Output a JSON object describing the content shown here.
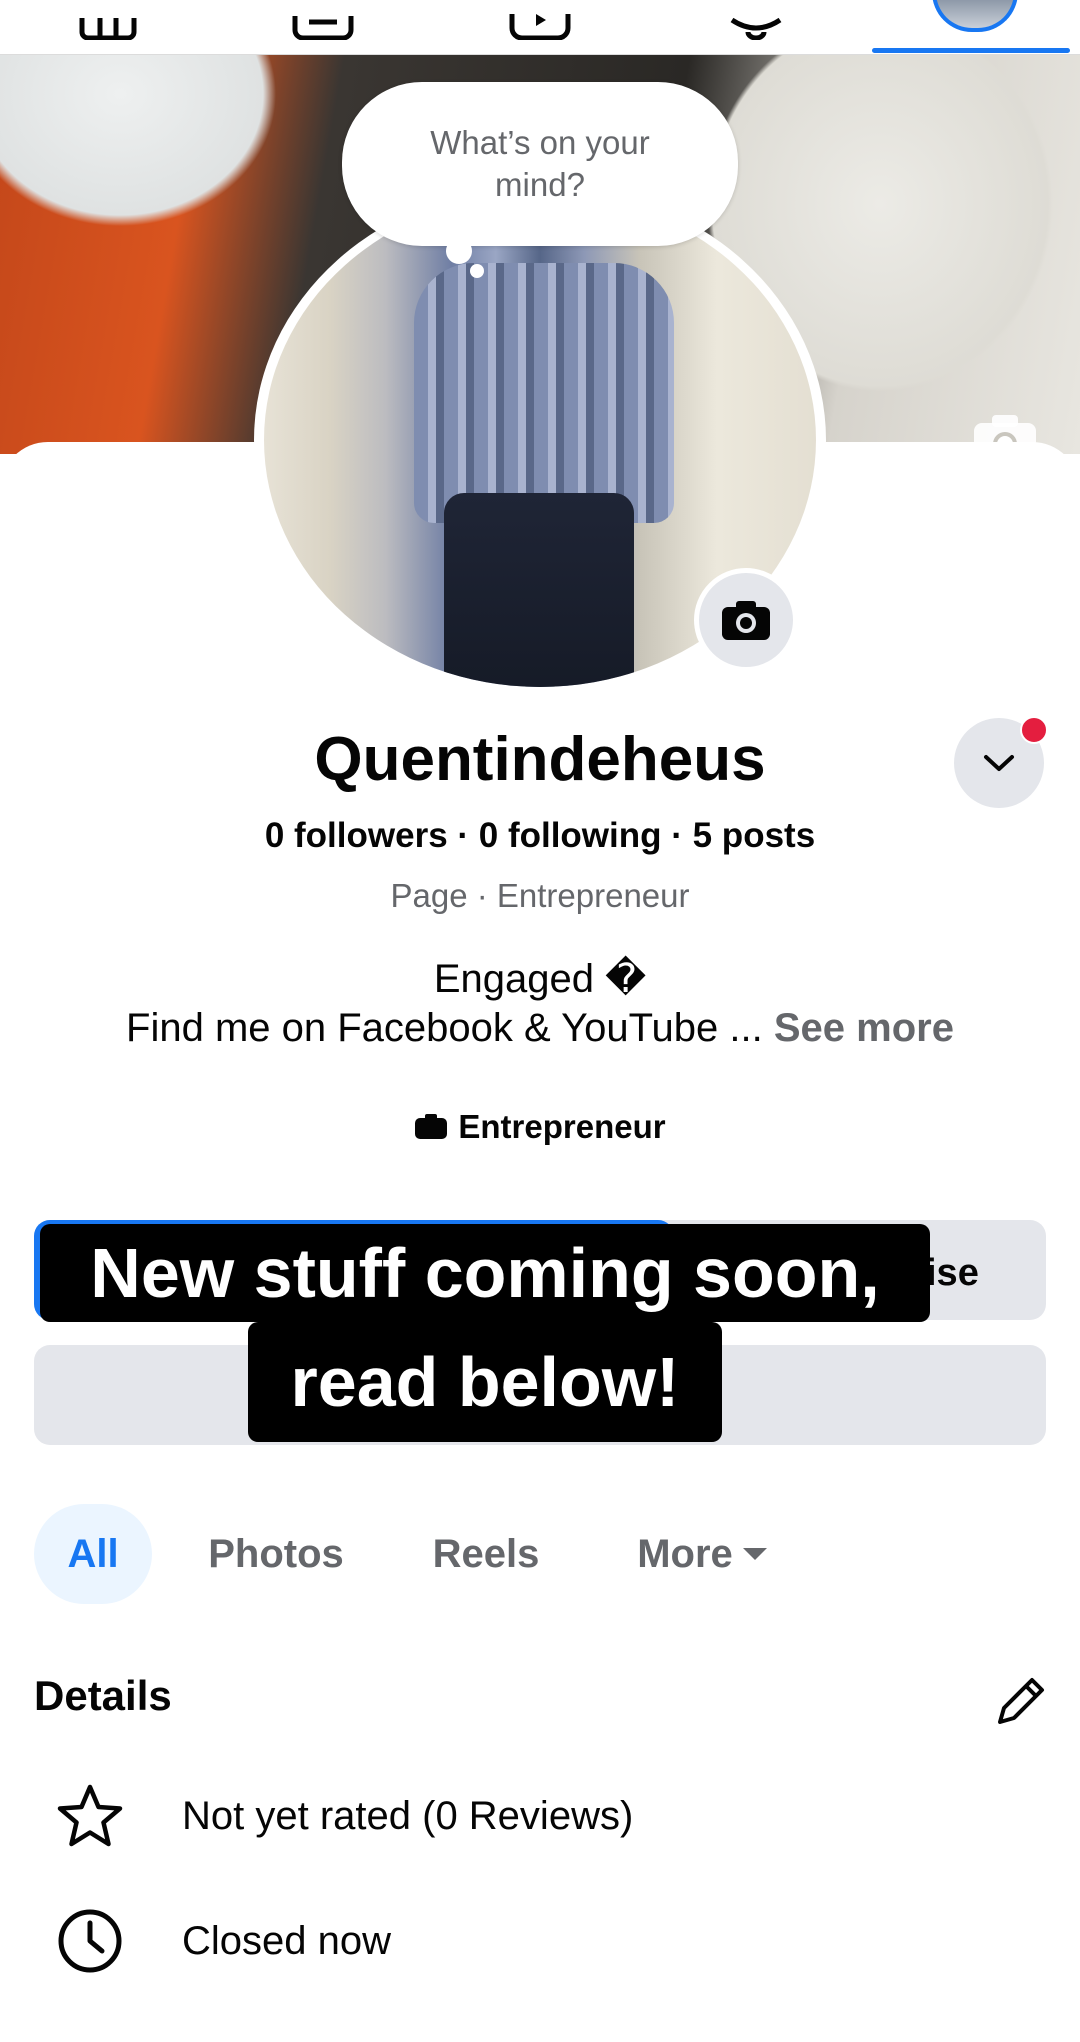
{
  "bubble": {
    "text": "What’s on your mind?"
  },
  "profile": {
    "name": "Quentindeheus",
    "stats": "0 followers · 0 following · 5 posts",
    "category_line": "Page · Entrepreneur",
    "bio_line1": "Engaged �",
    "bio_line2": "Find me on Facebook & YouTube ...",
    "see_more": "See more",
    "tag": "Entrepreneur"
  },
  "buttons": {
    "secondary_partial": "ise"
  },
  "caption": {
    "line1": "New stuff coming soon,",
    "line2": "read below!"
  },
  "tabs": [
    "All",
    "Photos",
    "Reels",
    "More"
  ],
  "details": {
    "title": "Details",
    "items": [
      {
        "icon": "star-icon",
        "text": "Not yet rated (0 Reviews)"
      },
      {
        "icon": "clock-icon",
        "text": "Closed now"
      }
    ]
  },
  "colors": {
    "accent": "#1877f2",
    "notification": "#e41e3f"
  }
}
